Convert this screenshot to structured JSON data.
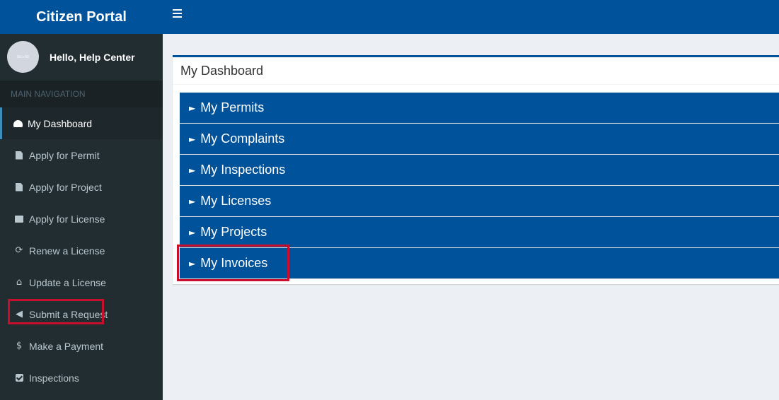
{
  "app": {
    "title": "Citizen Portal"
  },
  "user": {
    "avatar_text": "50 x 50",
    "greeting": "Hello, Help Center"
  },
  "sidebar": {
    "header": "MAIN NAVIGATION",
    "items": [
      {
        "label": "My Dashboard",
        "icon": "dashboard-icon"
      },
      {
        "label": "Apply for Permit",
        "icon": "document-icon"
      },
      {
        "label": "Apply for Project",
        "icon": "document-icon"
      },
      {
        "label": "Apply for License",
        "icon": "briefcase-icon"
      },
      {
        "label": "Renew a License",
        "icon": "refresh-icon"
      },
      {
        "label": "Update a License",
        "icon": "home-icon"
      },
      {
        "label": "Submit a Request",
        "icon": "megaphone-icon"
      },
      {
        "label": "Make a Payment",
        "icon": "dollar-icon"
      },
      {
        "label": "Inspections",
        "icon": "check-square-icon"
      }
    ]
  },
  "dashboard": {
    "title": "My Dashboard",
    "panels": [
      {
        "label": "My Permits"
      },
      {
        "label": "My Complaints"
      },
      {
        "label": "My Inspections"
      },
      {
        "label": "My Licenses"
      },
      {
        "label": "My Projects"
      },
      {
        "label": "My Invoices"
      }
    ]
  },
  "colors": {
    "brand": "#00529b",
    "sidebar": "#222d32",
    "highlight": "#c8102e"
  }
}
